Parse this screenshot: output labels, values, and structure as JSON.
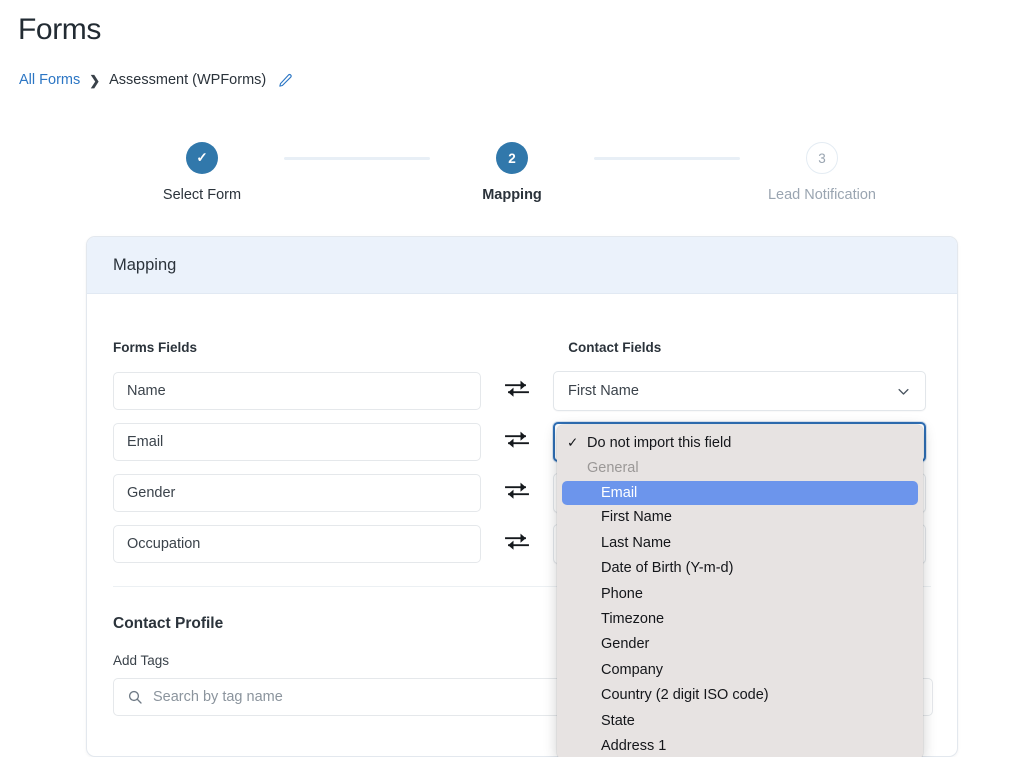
{
  "page": {
    "title": "Forms"
  },
  "breadcrumb": {
    "root_label": "All Forms",
    "separator": "›",
    "current_label": "Assessment (WPForms)",
    "edit_icon": "pencil-icon"
  },
  "stepper": {
    "steps": [
      {
        "number": "1",
        "marker": "✓",
        "label": "Select Form",
        "state": "done"
      },
      {
        "number": "2",
        "marker": "2",
        "label": "Mapping",
        "state": "active"
      },
      {
        "number": "3",
        "marker": "3",
        "label": "Lead Notification",
        "state": "todo"
      }
    ]
  },
  "card": {
    "header_title": "Mapping",
    "columns": {
      "left_heading": "Forms Fields",
      "right_heading": "Contact Fields"
    },
    "rows": [
      {
        "form_field": "Name",
        "contact_field": "First Name",
        "swap_icon": "swap-horizontal-icon"
      },
      {
        "form_field": "Email",
        "contact_field": "",
        "swap_icon": "swap-horizontal-icon"
      },
      {
        "form_field": "Gender",
        "contact_field": "",
        "swap_icon": "swap-horizontal-icon"
      },
      {
        "form_field": "Occupation",
        "contact_field": "",
        "swap_icon": "swap-horizontal-icon"
      }
    ],
    "contact_profile": {
      "section_title": "Contact Profile",
      "add_tags_label": "Add Tags",
      "tag_search_placeholder": "Search by tag name",
      "tag_search_value": "",
      "search_icon": "search-icon"
    }
  },
  "dropdown": {
    "open": true,
    "selected_value": "Email",
    "checked_value": "Do not import this field",
    "items": [
      {
        "label": "Do not import this field",
        "type": "option",
        "checked": true,
        "highlighted": false
      },
      {
        "label": "General",
        "type": "group",
        "checked": false,
        "highlighted": false
      },
      {
        "label": "Email",
        "type": "option",
        "checked": false,
        "highlighted": true
      },
      {
        "label": "First Name",
        "type": "option",
        "checked": false,
        "highlighted": false
      },
      {
        "label": "Last Name",
        "type": "option",
        "checked": false,
        "highlighted": false
      },
      {
        "label": "Date of Birth (Y-m-d)",
        "type": "option",
        "checked": false,
        "highlighted": false
      },
      {
        "label": "Phone",
        "type": "option",
        "checked": false,
        "highlighted": false
      },
      {
        "label": "Timezone",
        "type": "option",
        "checked": false,
        "highlighted": false
      },
      {
        "label": "Gender",
        "type": "option",
        "checked": false,
        "highlighted": false
      },
      {
        "label": "Company",
        "type": "option",
        "checked": false,
        "highlighted": false
      },
      {
        "label": "Country (2 digit ISO code)",
        "type": "option",
        "checked": false,
        "highlighted": false
      },
      {
        "label": "State",
        "type": "option",
        "checked": false,
        "highlighted": false
      },
      {
        "label": "Address 1",
        "type": "option",
        "checked": false,
        "highlighted": false
      }
    ],
    "check_glyph": "✓"
  },
  "colors": {
    "accent_blue": "#3178ab",
    "link_blue": "#2c76c4",
    "card_header_bg": "#ebf2fb",
    "dropdown_bg": "#e7e3e2",
    "dropdown_highlight": "#6c95ec",
    "focus_border": "#2f6fb5"
  }
}
